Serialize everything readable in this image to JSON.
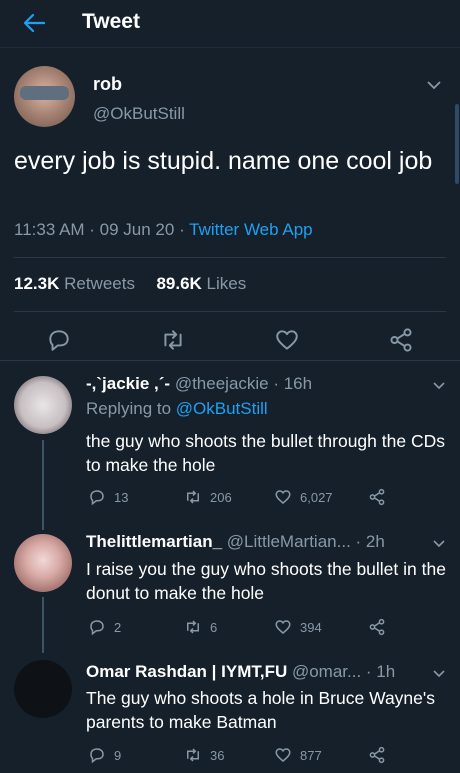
{
  "header": {
    "title": "Tweet"
  },
  "tweet": {
    "name": "rob",
    "handle": "@OkButStill",
    "text": "every job is stupid. name one cool job",
    "time": "11:33 AM · 09 Jun 20 · ",
    "source": "Twitter Web App",
    "retweets_count": "12.3K",
    "retweets_label": " Retweets",
    "likes_count": "89.6K",
    "likes_label": " Likes"
  },
  "replies": [
    {
      "name": "-,`jackie ,´-",
      "handle_time": " @theejackie · 16h",
      "replying_prefix": "Replying to ",
      "replying_to": "@OkButStill",
      "text": "the guy who shoots the bullet through the CDs to make the hole",
      "replies": "13",
      "retweets": "206",
      "likes": "6,027"
    },
    {
      "name": "Thelittlemartian_",
      "handle_time": " @LittleMartian... · 2h",
      "text": "I raise you the guy who shoots the bullet in the donut to make the hole",
      "replies": "2",
      "retweets": "6",
      "likes": "394"
    },
    {
      "name": "Omar Rashdan | IYMT,FU",
      "handle_time": " @omar... · 1h",
      "text": "The guy who shoots a hole in Bruce Wayne's parents to make Batman",
      "replies": "9",
      "retweets": "36",
      "likes": "877"
    }
  ],
  "icons": [
    "back-arrow-icon",
    "chevron-down-icon",
    "reply-icon",
    "retweet-icon",
    "like-icon",
    "share-icon"
  ],
  "colors": {
    "background": "#15202b",
    "accent": "#1da1f2",
    "muted": "#8899a6"
  }
}
